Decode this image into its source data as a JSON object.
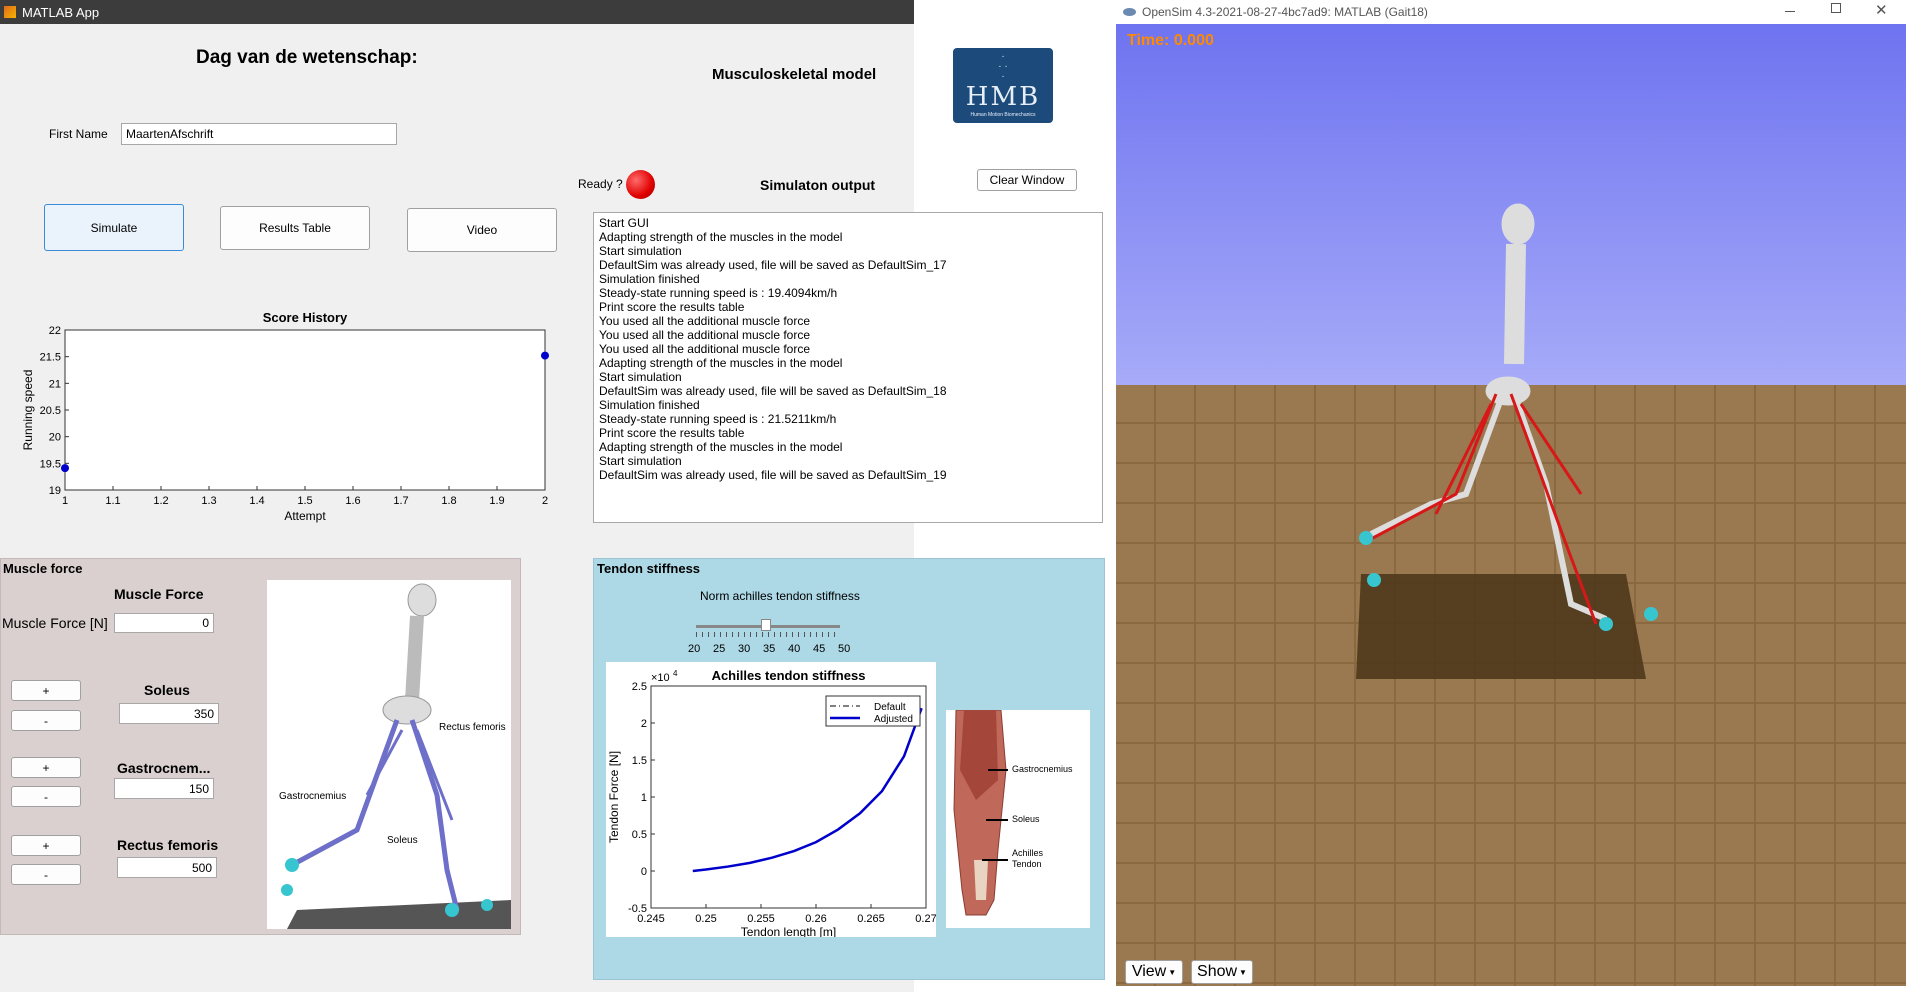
{
  "matlab": {
    "title": "MATLAB App",
    "heading": "Dag van de wetenschap:",
    "model_label": "Musculoskeletal model",
    "logo_text": "HMB",
    "logo_subtext": "Human Motion Biomechanics",
    "first_name_label": "First Name",
    "first_name_value": "MaartenAfschrift",
    "ready_label": "Ready ?",
    "sim_output_title": "Simulaton output",
    "clear_button": "Clear Window",
    "buttons": {
      "simulate": "Simulate",
      "results": "Results Table",
      "video": "Video"
    },
    "output_lines": [
      "Start GUI",
      "Adapting strength of the muscles in the model",
      "Start simulation",
      "DefaultSim was already used, file will be saved as DefaultSim_17",
      "Simulation finished",
      "Steady-state running speed is : 19.4094km/h",
      "Print score the results table",
      "You used all the additional muscle force",
      "You used all the additional muscle force",
      "You used all the additional muscle force",
      "Adapting strength of the muscles in the model",
      "Start simulation",
      "DefaultSim was already used, file will be saved as DefaultSim_18",
      "Simulation finished",
      "Steady-state running speed is : 21.5211km/h",
      "Print score the results table",
      "Adapting strength of the muscles in the model",
      "Start simulation",
      "DefaultSim was already used, file will be saved as DefaultSim_19"
    ],
    "muscle_panel": {
      "title": "Muscle force",
      "subtitle": "Muscle Force",
      "force_label": "Muscle Force [N]",
      "force_value": "0",
      "plus": "+",
      "minus": "-",
      "muscles": [
        {
          "name": "Soleus",
          "value": "350"
        },
        {
          "name": "Gastrocnem...",
          "value": "150"
        },
        {
          "name": "Rectus femoris",
          "value": "500"
        }
      ],
      "image_labels": {
        "rectus": "Rectus femoris",
        "gastro": "Gastrocnemius",
        "soleus": "Soleus"
      }
    },
    "tendon_panel": {
      "title": "Tendon stiffness",
      "slider_label": "Norm achilles tendon stiffness",
      "slider_ticks": [
        "20",
        "25",
        "30",
        "35",
        "40",
        "45",
        "50"
      ],
      "slider_value": 35,
      "image_labels": {
        "gastro": "Gastrocnemius",
        "soleus": "Soleus",
        "achilles1": "Achilles",
        "achilles2": "Tendon"
      }
    }
  },
  "opensim": {
    "title": "OpenSim 4.3-2021-08-27-4bc7ad9: MATLAB (Gait18)",
    "time_label": "Time:  0.000",
    "view_button": "View",
    "show_button": "Show"
  },
  "chart_data": [
    {
      "type": "scatter",
      "title": "Score History",
      "xlabel": "Attempt",
      "ylabel": "Running speed",
      "x": [
        1,
        2
      ],
      "y": [
        19.41,
        21.52
      ],
      "xlim": [
        1,
        2
      ],
      "ylim": [
        19,
        22
      ],
      "xticks": [
        "1",
        "1.1",
        "1.2",
        "1.3",
        "1.4",
        "1.5",
        "1.6",
        "1.7",
        "1.8",
        "1.9",
        "2"
      ],
      "yticks": [
        "19",
        "19.5",
        "20",
        "20.5",
        "21",
        "21.5",
        "22"
      ],
      "color": "#0000cc"
    },
    {
      "type": "line",
      "title": "Achilles tendon stiffness",
      "xlabel": "Tendon length [m]",
      "ylabel": "Tendon Force [N]",
      "y_multiplier": "×10",
      "y_multiplier_exp": "4",
      "xlim": [
        0.245,
        0.27
      ],
      "ylim": [
        -0.5,
        2.5
      ],
      "xticks": [
        "0.245",
        "0.25",
        "0.255",
        "0.26",
        "0.265",
        "0.27"
      ],
      "yticks": [
        "-0.5",
        "0",
        "0.5",
        "1",
        "1.5",
        "2",
        "2.5"
      ],
      "series": [
        {
          "name": "Default",
          "style": "dashdot",
          "color": "#000000",
          "x": [],
          "y": []
        },
        {
          "name": "Adjusted",
          "style": "solid",
          "color": "#0000cc",
          "x": [
            0.2488,
            0.25,
            0.252,
            0.254,
            0.256,
            0.258,
            0.26,
            0.262,
            0.264,
            0.266,
            0.268,
            0.2696
          ],
          "y": [
            0.0,
            0.02,
            0.06,
            0.11,
            0.18,
            0.27,
            0.39,
            0.56,
            0.78,
            1.08,
            1.55,
            2.2
          ]
        }
      ]
    }
  ]
}
